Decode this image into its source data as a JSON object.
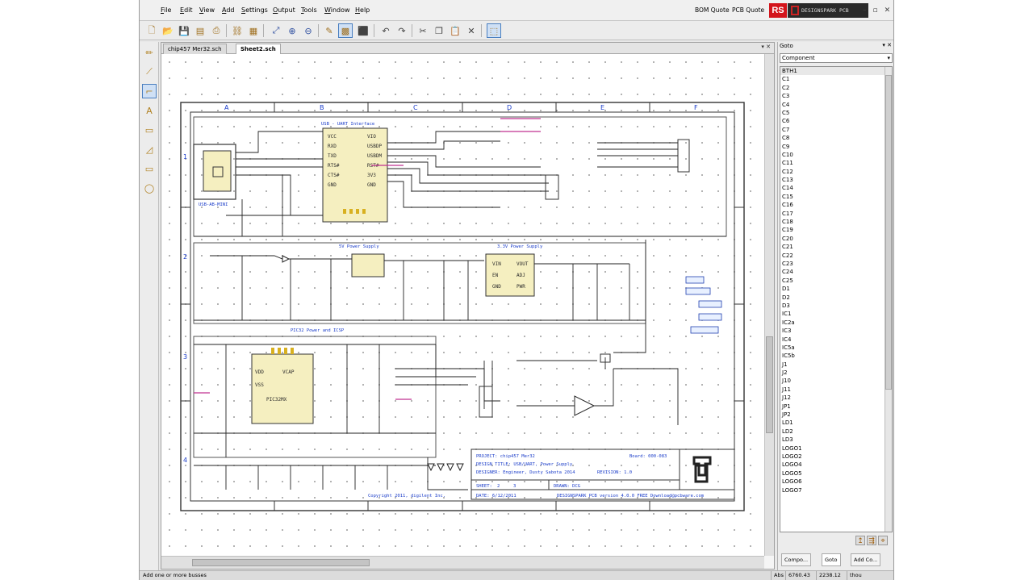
{
  "menu": [
    "File",
    "Edit",
    "View",
    "Add",
    "Settings",
    "Output",
    "Tools",
    "Window",
    "Help"
  ],
  "quotes": [
    "BOM Quote",
    "PCB Quote"
  ],
  "brand": {
    "rs": "RS",
    "ds": "DESIGNSPARK PCB"
  },
  "tabs": [
    "chip457 Mer32.sch",
    "Sheet2.sch"
  ],
  "goto": {
    "title": "Goto",
    "filter": "Component",
    "items": [
      "BTH1",
      "C1",
      "C2",
      "C3",
      "C4",
      "C5",
      "C6",
      "C7",
      "C8",
      "C9",
      "C10",
      "C11",
      "C12",
      "C13",
      "C14",
      "C15",
      "C16",
      "C17",
      "C18",
      "C19",
      "C20",
      "C21",
      "C22",
      "C23",
      "C24",
      "C25",
      "D1",
      "D2",
      "D3",
      "IC1",
      "IC2a",
      "IC3",
      "IC4",
      "IC5a",
      "IC5b",
      "J1",
      "J2",
      "J10",
      "J11",
      "J12",
      "JP1",
      "JP2",
      "LD1",
      "LD2",
      "LD3",
      "LOGO1",
      "LOGO2",
      "LOGO4",
      "LOGO5",
      "LOGO6",
      "LOGO7"
    ],
    "panel_tabs": [
      "Compo...",
      "Goto",
      "Add Co..."
    ]
  },
  "status": {
    "text": "Add one or more busses",
    "f1": "Abs",
    "f2": "6760.43",
    "f3": "2238.12",
    "f4": "thou"
  },
  "sheet": {
    "cols": [
      "A",
      "B",
      "C",
      "D",
      "E",
      "F"
    ],
    "rows": [
      "1",
      "2",
      "3",
      "4"
    ],
    "blocks": {
      "usb": "USB - UART Interface",
      "p5v": "5V Power Supply",
      "p33": "3.3V Power Supply",
      "pic": "PIC32 Power and ICSP",
      "usb_conn": "USB-AB-MINI"
    },
    "title_block": {
      "project": "PROJECT:  chip457 Mer32",
      "design": "DESIGN TITLE:  USB/UART, Power Supply",
      "designer": "DESIGNER:  Engineer, Dusty Sabota 2014",
      "sheet_label": "SHEET:",
      "sheet_no": "2",
      "sheet_of": "3",
      "date_label": "DATE:  6/12/2011",
      "drawn": "DRAWN:  DCG",
      "revision": "REVISION: 1.0",
      "board": "Board: 000-083",
      "footer": "DESIGNSPARK PCB version 4.0.0 FREE Download@pcbware.com",
      "copyright": "Copyright 2011, digilent Inc."
    }
  }
}
